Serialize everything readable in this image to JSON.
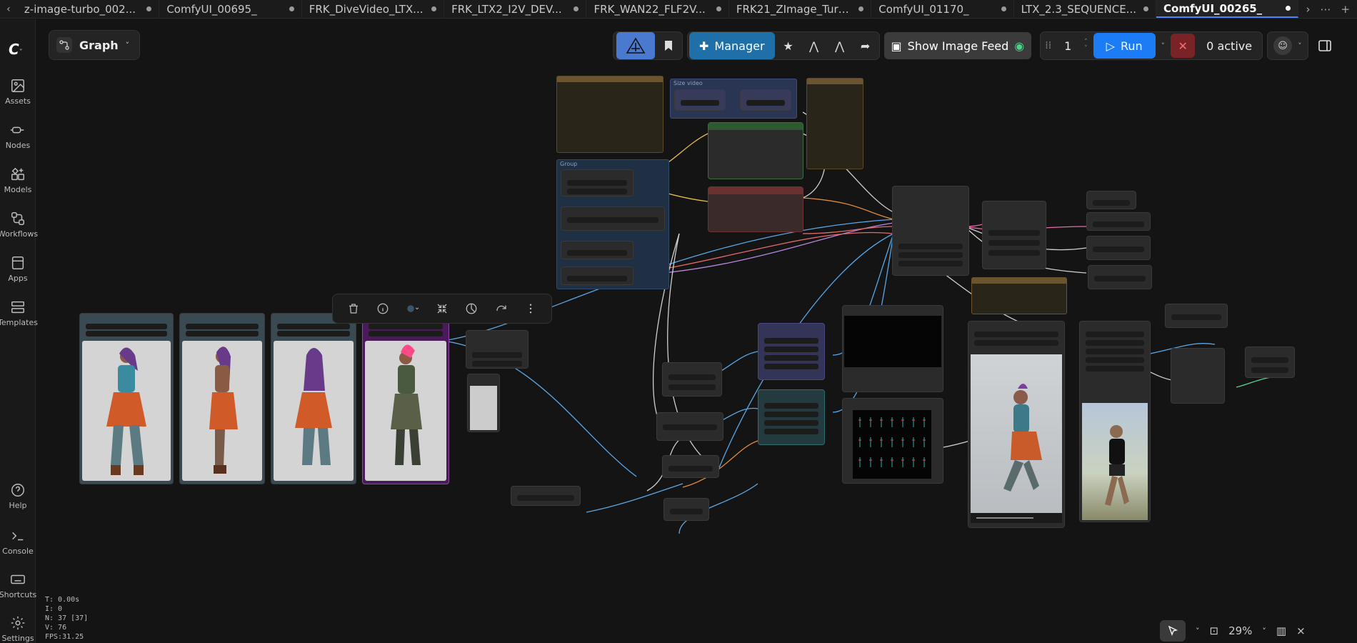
{
  "tabs": [
    {
      "label": "z-image-turbo_002...",
      "active": false
    },
    {
      "label": "ComfyUI_00695_",
      "active": false
    },
    {
      "label": "FRK_DiveVideo_LTX...",
      "active": false
    },
    {
      "label": "FRK_LTX2_I2V_DEV...",
      "active": false
    },
    {
      "label": "FRK_WAN22_FLF2V...",
      "active": false
    },
    {
      "label": "FRK21_ZImage_Turb...",
      "active": false
    },
    {
      "label": "ComfyUI_01170_",
      "active": false
    },
    {
      "label": "LTX_2.3_SEQUENCE...",
      "active": false
    },
    {
      "label": "ComfyUI_00265_",
      "active": true
    }
  ],
  "sidebar": {
    "items": [
      {
        "label": "Assets",
        "icon": "image-icon"
      },
      {
        "label": "Nodes",
        "icon": "nodes-icon"
      },
      {
        "label": "Models",
        "icon": "models-icon"
      },
      {
        "label": "Workflows",
        "icon": "workflows-icon"
      },
      {
        "label": "Apps",
        "icon": "apps-icon"
      },
      {
        "label": "Templates",
        "icon": "templates-icon"
      }
    ],
    "bottom": [
      {
        "label": "Help",
        "icon": "help-icon"
      },
      {
        "label": "Console",
        "icon": "console-icon"
      },
      {
        "label": "Shortcuts",
        "icon": "keyboard-icon"
      },
      {
        "label": "Settings",
        "icon": "gear-icon"
      }
    ]
  },
  "graph_button": {
    "label": "Graph"
  },
  "toolbar": {
    "manager_label": "Manager",
    "show_feed_label": "Show Image Feed",
    "queue_count": "1",
    "run_label": "Run",
    "active_label": "0 active"
  },
  "stats": {
    "t": "T: 0.00s",
    "i": "I: 0",
    "n": "N: 37 [37]",
    "v": "V: 76",
    "fps": "FPS:31.25"
  },
  "groups": [
    {
      "title": ""
    },
    {
      "title": "Size video"
    },
    {
      "title": "Group"
    }
  ],
  "zoom": {
    "level": "29%"
  },
  "colors": {
    "accent": "#1b7cf5",
    "manager": "#1f6fa8",
    "cancel": "#7a2327",
    "selected_node": "#4a1a5a"
  }
}
